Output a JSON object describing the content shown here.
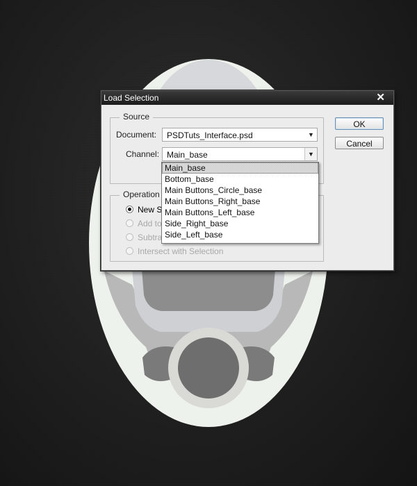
{
  "dialog": {
    "title": "Load Selection",
    "close_glyph": "✕",
    "source": {
      "legend": "Source",
      "document_label": "Document:",
      "document_value": "PSDTuts_Interface.psd",
      "channel_label": "Channel:",
      "channel_value": "Main_base"
    },
    "operation": {
      "legend": "Operation",
      "options": [
        {
          "label": "New Selection",
          "checked": true,
          "disabled": false
        },
        {
          "label": "Add to Selection",
          "checked": false,
          "disabled": true
        },
        {
          "label": "Subtract from Selection",
          "checked": false,
          "disabled": true
        },
        {
          "label": "Intersect with Selection",
          "checked": false,
          "disabled": true
        }
      ]
    },
    "buttons": {
      "ok": "OK",
      "cancel": "Cancel"
    },
    "channel_dropdown": {
      "items": [
        "Main_base",
        "Bottom_base",
        "Main Buttons_Circle_base",
        "Main Buttons_Right_base",
        "Main Buttons_Left_base",
        "Side_Right_base",
        "Side_Left_base"
      ],
      "selected_index": 0
    }
  },
  "colors": {
    "background": "#1f1f1f",
    "device_shell": "#eef2ec",
    "device_inner": "#cfcfd3",
    "device_grey": "#9a9a9a",
    "device_dark": "#6f6f6f"
  },
  "icons": {
    "dropdown_arrow": "▼"
  }
}
